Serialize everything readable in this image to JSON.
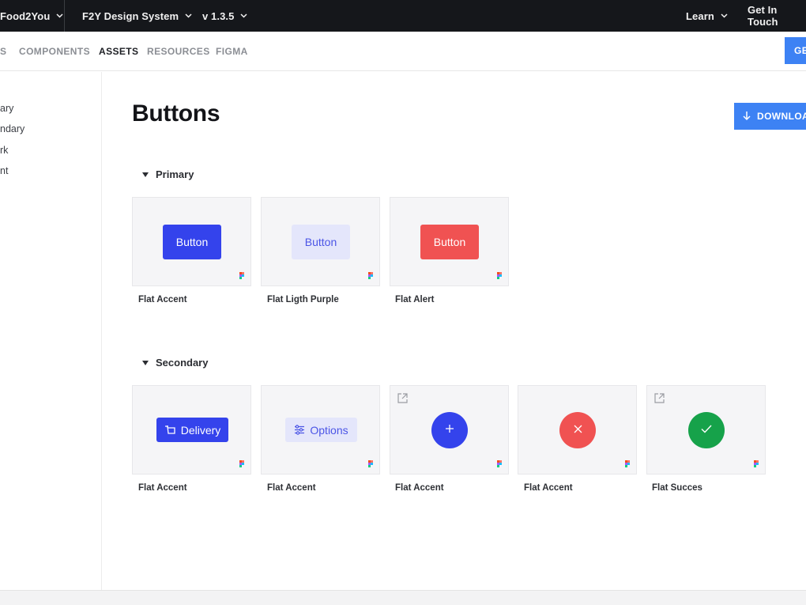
{
  "topbar": {
    "brand": "Food2You",
    "product": "F2Y Design System",
    "version": "v 1.3.5",
    "learn": "Learn",
    "get_in_touch": "Get In Touch"
  },
  "subnav": {
    "items": [
      "S",
      "COMPONENTS",
      "ASSETS",
      "RESOURCES",
      "FIGMA"
    ],
    "active": "ASSETS",
    "get_button": "GE"
  },
  "sidebar": {
    "items": [
      "ary",
      "ndary",
      "rk",
      "nt"
    ]
  },
  "main": {
    "title": "Buttons",
    "download_label": "DOWNLOA",
    "sections": [
      {
        "title": "Primary",
        "cards": [
          {
            "button_text": "Button",
            "label": "Flat Accent"
          },
          {
            "button_text": "Button",
            "label": "Flat Ligth Purple"
          },
          {
            "button_text": "Button",
            "label": "Flat Alert"
          }
        ]
      },
      {
        "title": "Secondary",
        "cards": [
          {
            "button_text": "Delivery",
            "icon": "delivery-icon",
            "label": "Flat Accent"
          },
          {
            "button_text": "Options",
            "icon": "sliders-icon",
            "label": "Flat Accent"
          },
          {
            "icon": "plus-icon",
            "label": "Flat Accent"
          },
          {
            "icon": "close-icon",
            "label": "Flat Accent"
          },
          {
            "icon": "check-icon",
            "label": "Flat Succes"
          }
        ]
      }
    ]
  },
  "colors": {
    "topbar_bg": "#15171b",
    "accent": "#3443ec",
    "light_purple": "#e4e6fb",
    "alert": "#f05252",
    "success": "#16a24a",
    "link_blue": "#3d82f4"
  }
}
